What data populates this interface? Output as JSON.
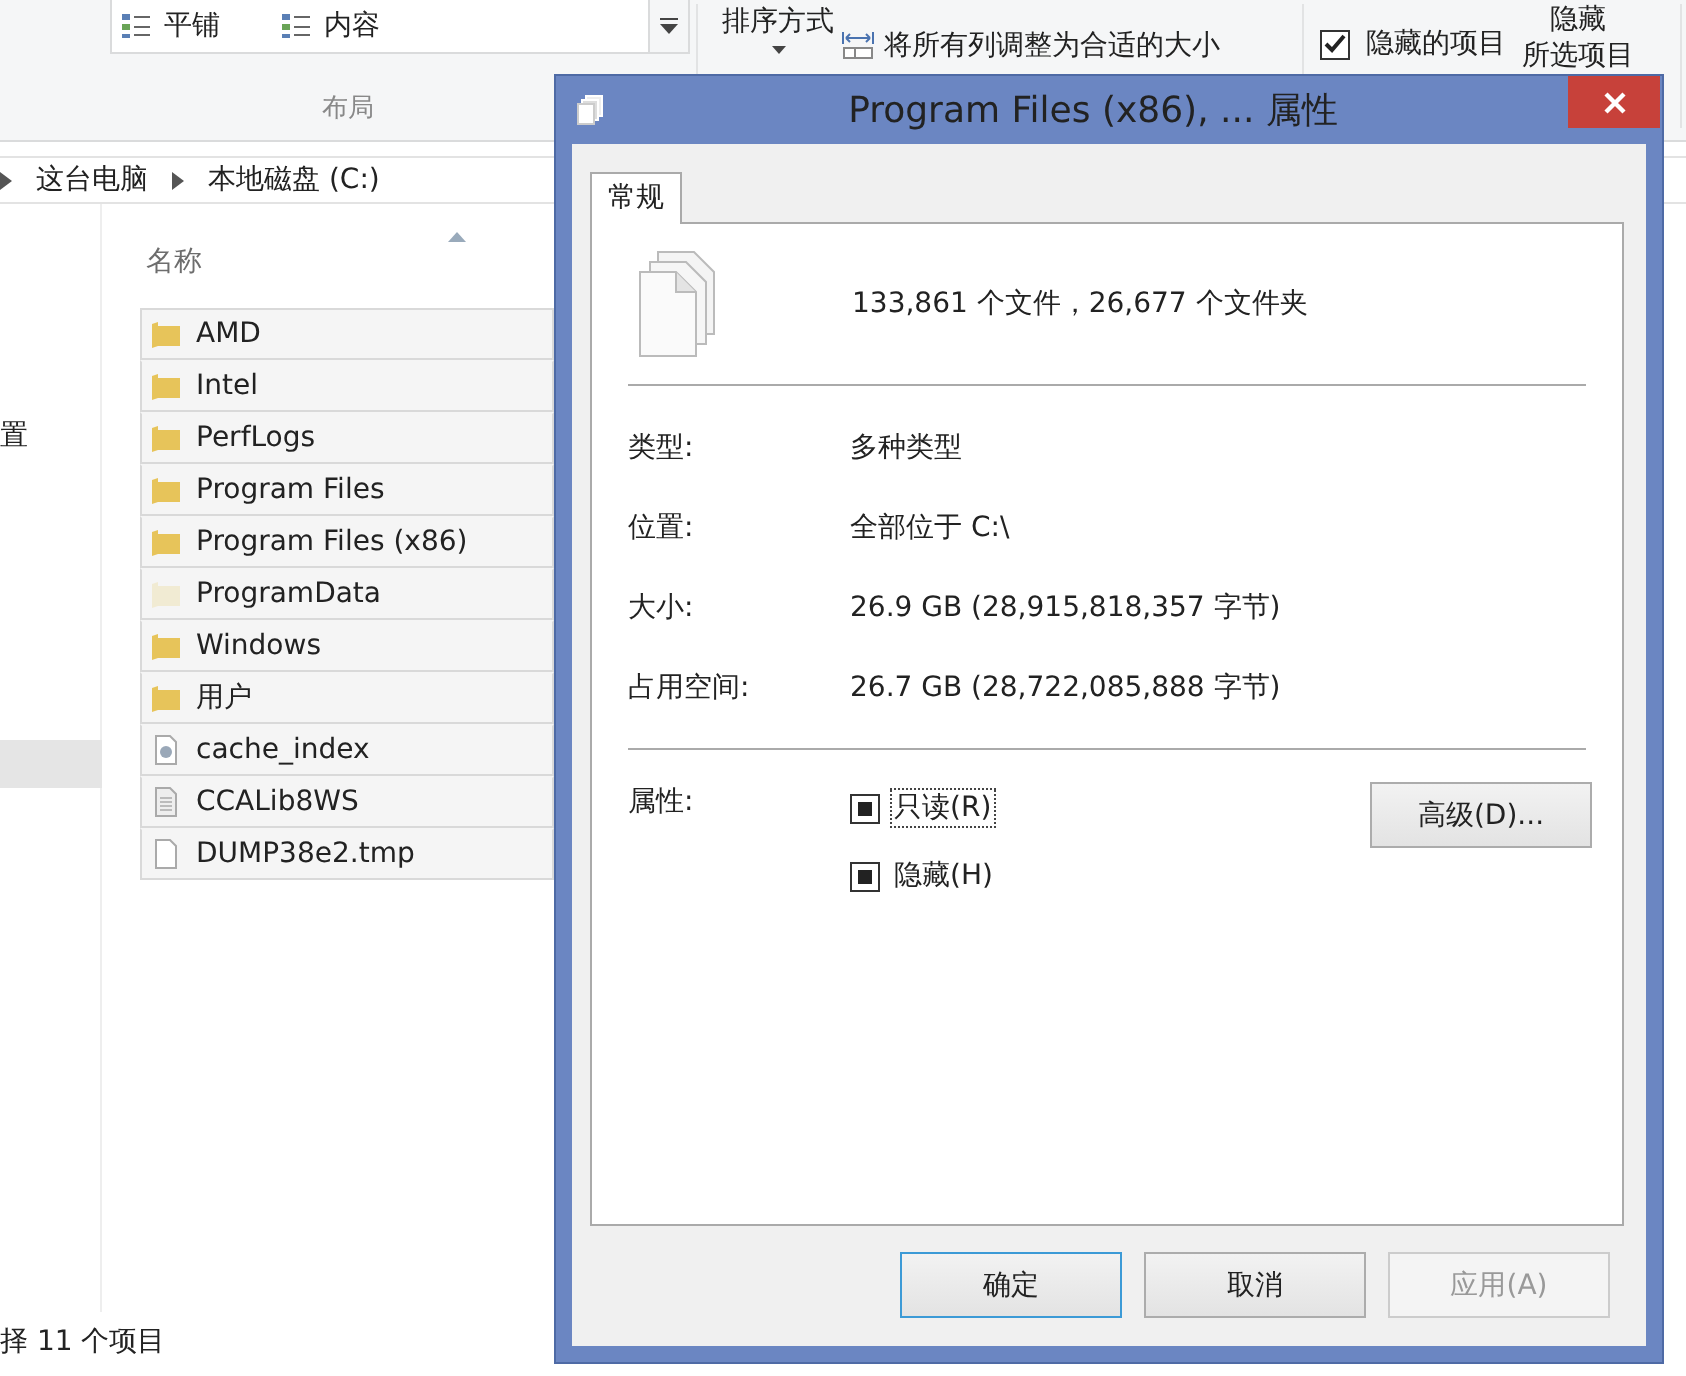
{
  "ribbon": {
    "layout_items": [
      {
        "label": "平铺"
      },
      {
        "label": "内容"
      }
    ],
    "layout_group": "布局",
    "sort_label": "排序方式",
    "fit_columns": "将所有列调整为合适的大小",
    "hidden_items": {
      "label": "隐藏的项目",
      "checked": true
    },
    "hide_selected": [
      "隐藏",
      "所选项目"
    ]
  },
  "address_bar": {
    "path": [
      "这台电脑",
      "本地磁盘 (C:)"
    ]
  },
  "nav_pane": {
    "items": [
      {
        "label": "置",
        "selected": false
      },
      {
        "selected": true
      }
    ]
  },
  "file_list": {
    "column": "名称",
    "files": [
      {
        "name": "AMD",
        "kind": "folder",
        "hidden": false,
        "selected": true
      },
      {
        "name": "Intel",
        "kind": "folder",
        "hidden": false,
        "selected": true
      },
      {
        "name": "PerfLogs",
        "kind": "folder",
        "hidden": false,
        "selected": true
      },
      {
        "name": "Program Files",
        "kind": "folder",
        "hidden": false,
        "selected": true
      },
      {
        "name": "Program Files (x86)",
        "kind": "folder",
        "hidden": false,
        "selected": true
      },
      {
        "name": "ProgramData",
        "kind": "folder",
        "hidden": true,
        "selected": true
      },
      {
        "name": "Windows",
        "kind": "folder",
        "hidden": false,
        "selected": true
      },
      {
        "name": "用户",
        "kind": "folder",
        "hidden": false,
        "selected": true
      },
      {
        "name": "cache_index",
        "kind": "settings",
        "hidden": false,
        "selected": true
      },
      {
        "name": "CCALib8WS",
        "kind": "text",
        "hidden": false,
        "selected": true
      },
      {
        "name": "DUMP38e2.tmp",
        "kind": "file",
        "hidden": false,
        "selected": true
      }
    ]
  },
  "status_bar": "择 11 个项目",
  "dialog": {
    "title": "Program Files (x86), ... 属性",
    "tabs": [
      {
        "label": "常规",
        "selected": true
      }
    ],
    "summary": "133,861 个文件，26,677 个文件夹",
    "info": [
      {
        "label": "类型:",
        "value": "多种类型"
      },
      {
        "label": "位置:",
        "value": "全部位于 C:\\"
      },
      {
        "label": "大小:",
        "value": "26.9 GB (28,915,818,357 字节)"
      },
      {
        "label": "占用空间:",
        "value": "26.7 GB (28,722,085,888 字节)"
      }
    ],
    "attributes_label": "属性:",
    "attributes": [
      {
        "label": "只读(R)",
        "indeterminate": true,
        "focused": true
      },
      {
        "label": "隐藏(H)",
        "indeterminate": true,
        "focused": false
      }
    ],
    "advanced_button": "高级(D)...",
    "buttons": [
      {
        "label": "确定",
        "kind": "default",
        "disabled": false
      },
      {
        "label": "取消",
        "kind": "normal",
        "disabled": false
      },
      {
        "label": "应用(A)",
        "kind": "normal",
        "disabled": true
      }
    ]
  }
}
